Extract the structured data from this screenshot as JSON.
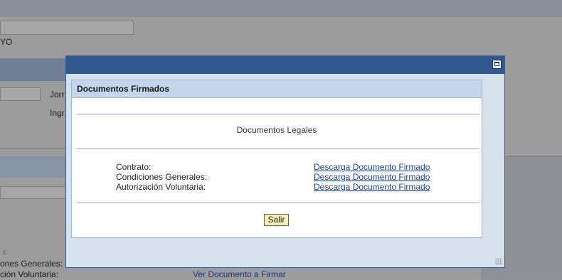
{
  "background": {
    "name_fragment": "YO",
    "label_jornada_fragment": "Jorr",
    "label_ingreso_fragment": "Ingr",
    "small_mark": "c",
    "label_condiciones_fragment": "ones Generales:",
    "label_autorizacion_fragment": "ción Voluntaria:",
    "link_ver_documento": "Ver Documento a Firmar"
  },
  "dialog": {
    "panel_title": "Documentos Firmados",
    "section_title": "Documentos Legales",
    "documents": [
      {
        "label": "Contrato:",
        "link": "Descarga Documento Firmado"
      },
      {
        "label": "Condiciones Generales:",
        "link": "Descarga Documento Firmado"
      },
      {
        "label": "Autorización Voluntaria:",
        "link": "Descarga Documento Firmado"
      }
    ],
    "exit_button": "Salir"
  },
  "colors": {
    "titlebar": "#30598f",
    "panel_header": "#c4d6ea",
    "link": "#1a3fa8",
    "exit_button_bg": "#f4f0b4"
  },
  "icons": {
    "titlebar_button": "maximize-icon",
    "corner": "resize-grip-icon"
  }
}
